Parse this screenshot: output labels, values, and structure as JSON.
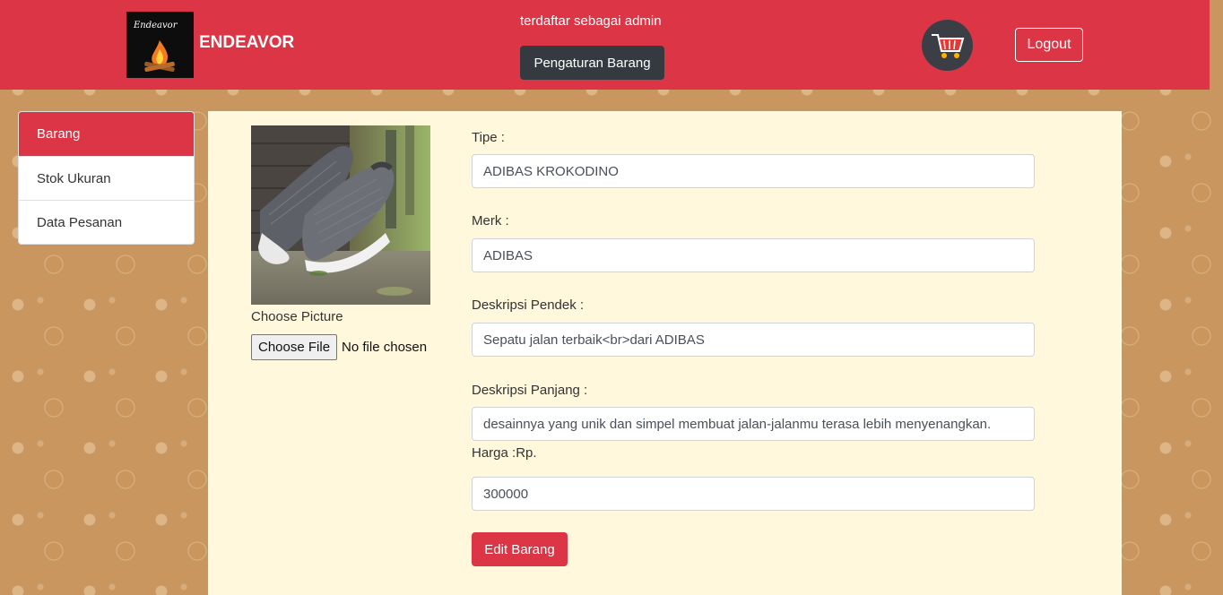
{
  "header": {
    "logo_script": "Endeavor",
    "brand": "ENDEAVOR",
    "registered_as": "terdaftar sebagai admin",
    "settings_button": "Pengaturan Barang",
    "cart_icon": "shopping-cart-icon",
    "logout_button": "Logout",
    "color": "#dc3545"
  },
  "sidebar": {
    "items": [
      {
        "label": "Barang",
        "active": true
      },
      {
        "label": "Stok Ukuran",
        "active": false
      },
      {
        "label": "Data Pesanan",
        "active": false
      }
    ]
  },
  "form": {
    "choose_picture_label": "Choose Picture",
    "file_button": "Choose File",
    "file_status": "No file chosen",
    "tipe_label": "Tipe :",
    "tipe_value": "ADIBAS KROKODINO",
    "merk_label": "Merk :",
    "merk_value": "ADIBAS",
    "desc_short_label": "Deskripsi Pendek :",
    "desc_short_value": "Sepatu jalan terbaik<br>dari ADIBAS",
    "desc_long_label": "Deskripsi Panjang :",
    "desc_long_value": "desainnya yang unik dan simpel membuat jalan-jalanmu terasa lebih menyenangkan.",
    "harga_label": "Harga :Rp.",
    "harga_value": "300000",
    "submit_button": "Edit Barang"
  }
}
